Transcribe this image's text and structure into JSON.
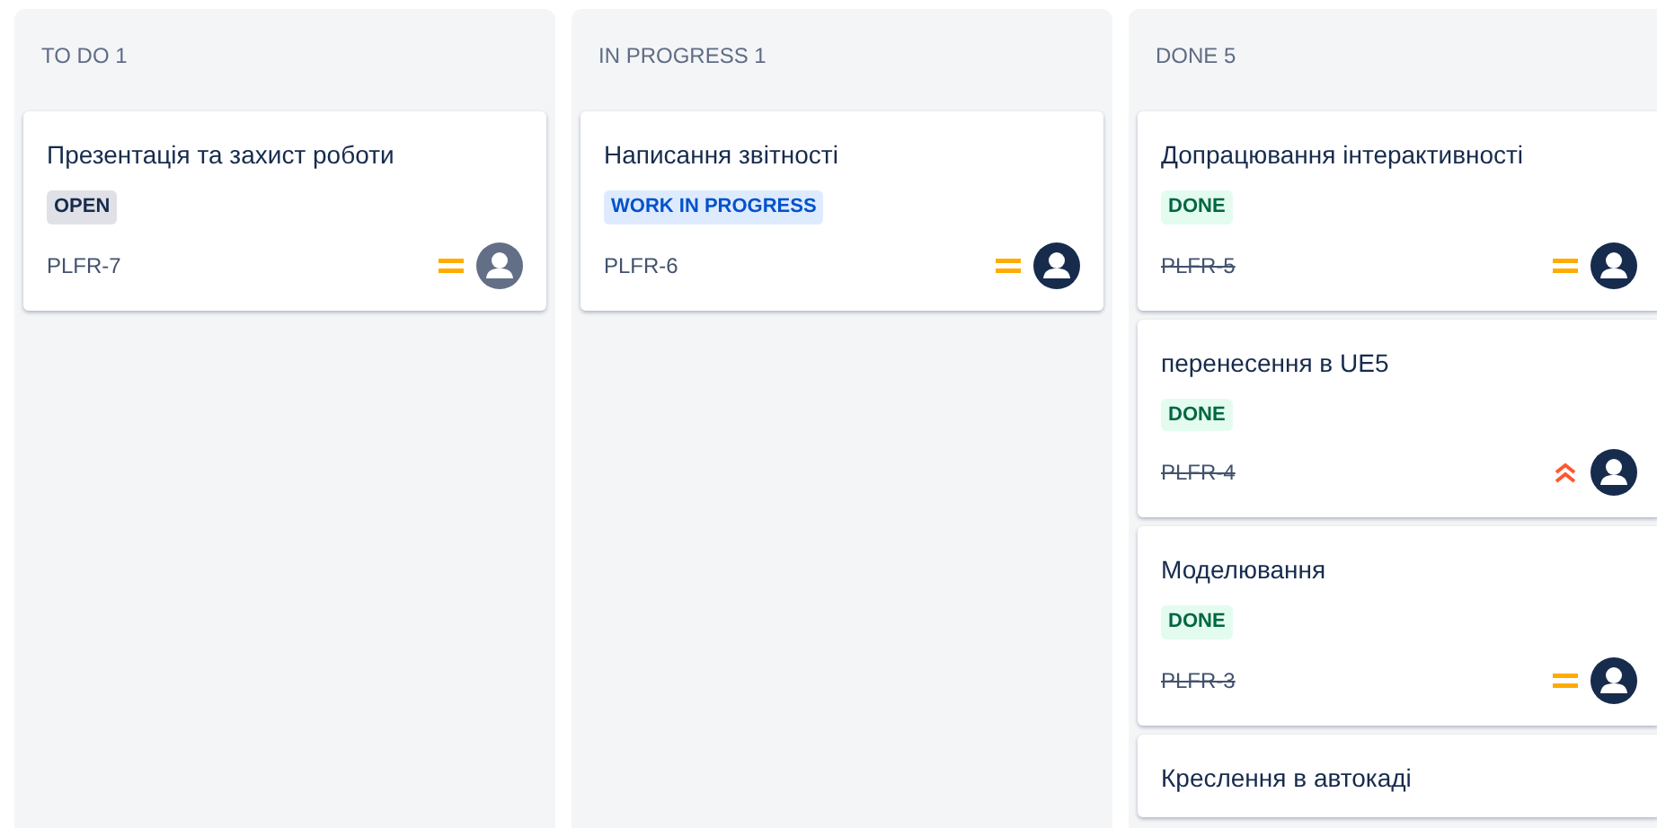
{
  "columns": [
    {
      "title": "TO DO 1",
      "cards": [
        {
          "title": "Презентація та захист роботи",
          "status": {
            "kind": "open",
            "label": "OPEN"
          },
          "key": "PLFR-7",
          "priority": {
            "kind": "medium"
          },
          "color": "#626f86"
        }
      ]
    },
    {
      "title": "IN PROGRESS 1",
      "cards": [
        {
          "title": "Написання звітності",
          "status": {
            "kind": "inprogress",
            "label": "WORK IN PROGRESS"
          },
          "key": "PLFR-6",
          "priority": {
            "kind": "medium"
          },
          "color": "#172b4d"
        }
      ]
    },
    {
      "title": "DONE 5",
      "cards": [
        {
          "title": "Допрацювання інтерактивності",
          "status": {
            "kind": "done",
            "label": "DONE"
          },
          "key": "PLFR-5",
          "priority": {
            "kind": "medium"
          },
          "color": "#172b4d"
        },
        {
          "title": "перенесення в UE5",
          "status": {
            "kind": "done",
            "label": "DONE"
          },
          "key": "PLFR-4",
          "priority": {
            "kind": "high"
          },
          "color": "#172b4d"
        },
        {
          "title": "Моделювання",
          "status": {
            "kind": "done",
            "label": "DONE"
          },
          "key": "PLFR-3",
          "priority": {
            "kind": "medium"
          },
          "color": "#172b4d"
        },
        {
          "title": "Креслення в автокаді"
        }
      ]
    }
  ]
}
